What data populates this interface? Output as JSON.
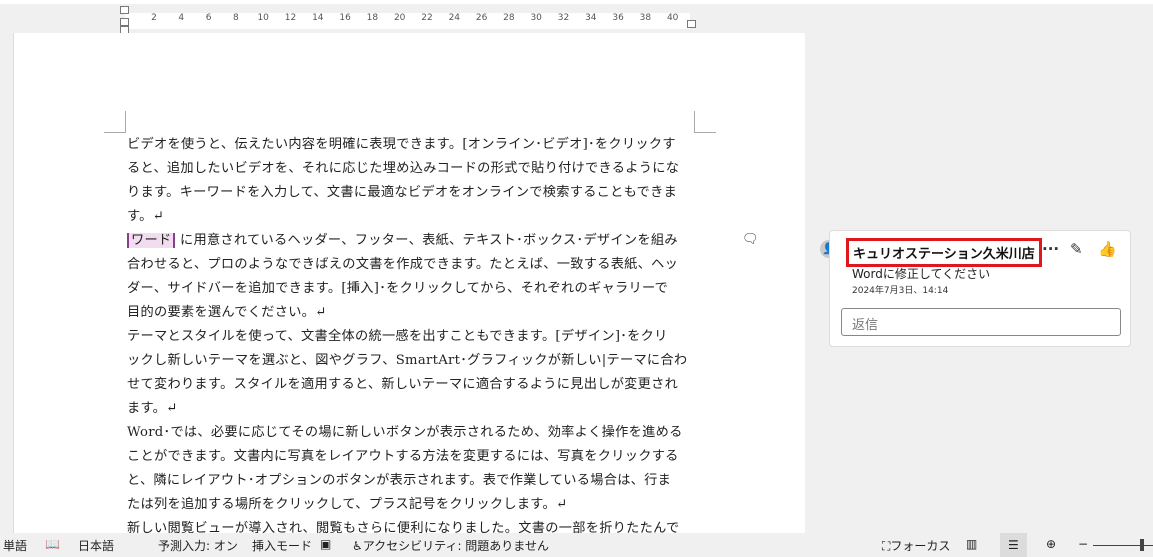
{
  "ruler": {
    "ticks": [
      "2",
      "4",
      "6",
      "8",
      "10",
      "12",
      "14",
      "16",
      "18",
      "20",
      "22",
      "24",
      "26",
      "28",
      "30",
      "32",
      "34",
      "36",
      "38",
      "40"
    ]
  },
  "document": {
    "lines": [
      "ビデオを使うと、伝えたい内容を明確に表現できます。[オンライン･ビデオ]･をクリックす",
      "ると、追加したいビデオを、それに応じた埋め込みコードの形式で貼り付けできるようにな",
      "ります。キーワードを入力して、文書に最適なビデオをオンラインで検索することもできま",
      "す。↵",
      "",
      "合わせると、プロのようなできばえの文書を作成できます。たとえば、一致する表紙、ヘッ",
      "ダー、サイドバーを追加できます。[挿入]･をクリックしてから、それぞれのギャラリーで",
      "目的の要素を選んでください。↵",
      "テーマとスタイルを使って、文書全体の統一感を出すこともできます。[デザイン]･をクリ",
      "ックし新しいテーマを選ぶと、図やグラフ、SmartArt･グラフィックが新しい|テーマに合わ",
      "せて変わります。スタイルを適用すると、新しいテーマに適合するように見出しが変更され",
      "ます。↵",
      "Word･では、必要に応じてその場に新しいボタンが表示されるため、効率よく操作を進める",
      "ことができます。文書内に写真をレイアウトする方法を変更するには、写真をクリックする",
      "と、隣にレイアウト･オプションのボタンが表示されます。表で作業している場合は、行ま",
      "たは列を追加する場所をクリックして、プラス記号をクリックします。↵",
      "新しい閲覧ビューが導入され、閲覧もさらに便利になりました。文書の一部を折りたたんで"
    ],
    "highlighted": "ワード",
    "highlighted_rest": "に用意されているヘッダー、フッター、表紙、テキスト･ボックス･デザインを組み"
  },
  "comment": {
    "author": "キュリオステーション久米川店",
    "text": "Wordに修正してください",
    "date": "2024年7月3日、14:14",
    "reply_placeholder": "返信",
    "more_icon": "···"
  },
  "status": {
    "word_count": "単語",
    "language": "日本語",
    "predict": "予測入力: オン",
    "insert_mode": "挿入モード",
    "accessibility": "アクセシビリティ: 問題ありません",
    "focus": "フォーカス"
  }
}
